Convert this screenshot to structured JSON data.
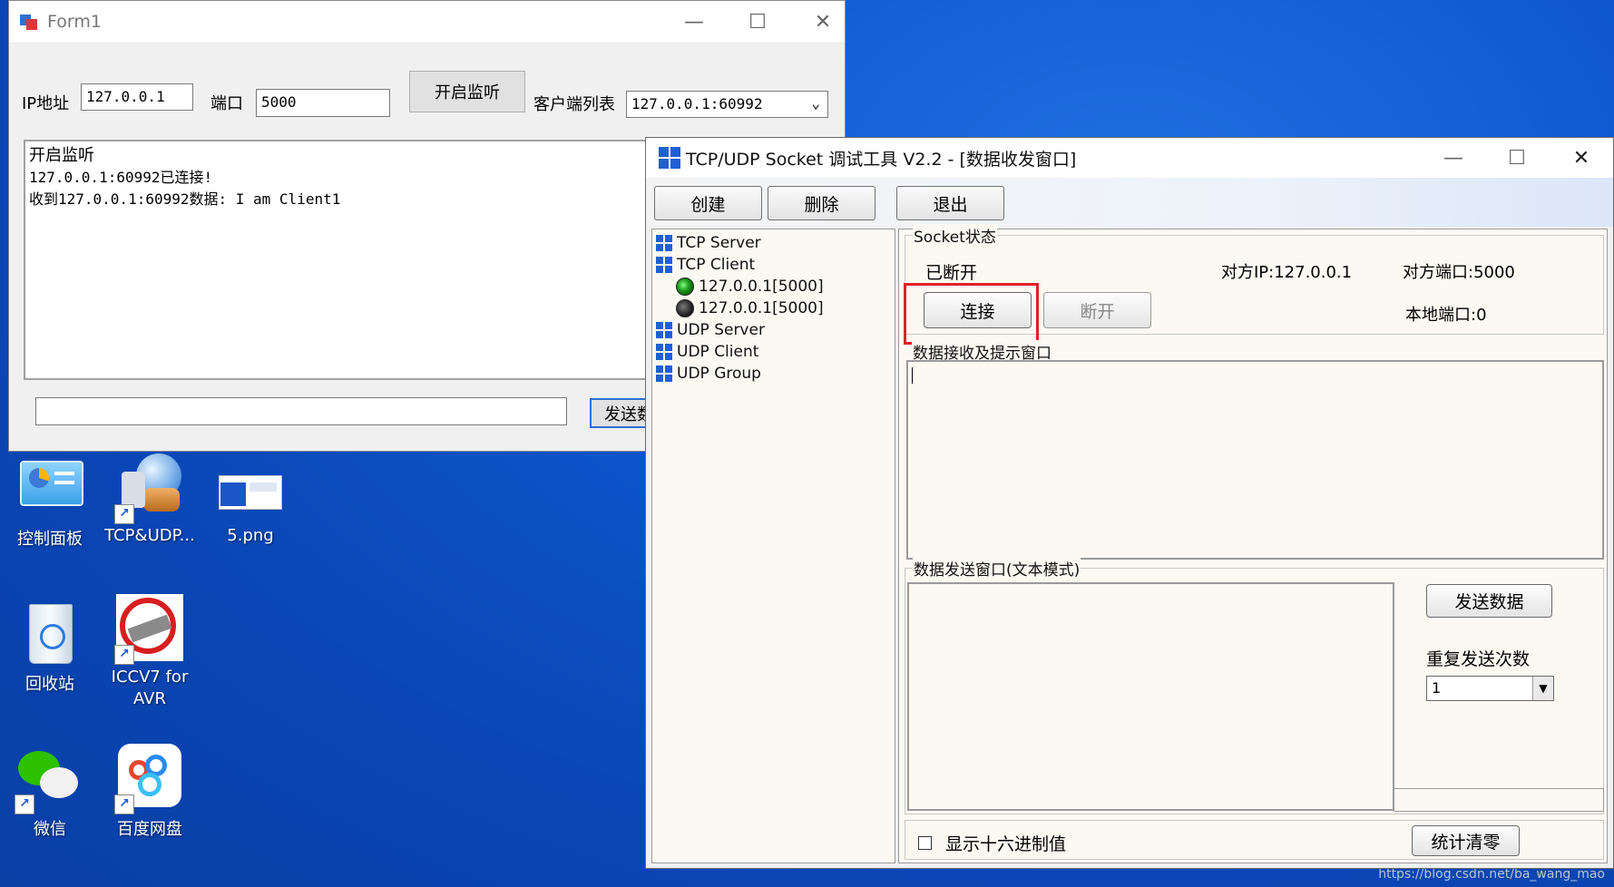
{
  "desktop": {
    "icons": [
      {
        "label": "控制面板"
      },
      {
        "label": "TCP&UDP..."
      },
      {
        "label": "5.png"
      },
      {
        "label": "回收站"
      },
      {
        "label": "ICCV7 for AVR"
      },
      {
        "label": "微信"
      },
      {
        "label": "百度网盘"
      }
    ],
    "watermark": "https://blog.csdn.net/ba_wang_mao"
  },
  "form1": {
    "title": "Form1",
    "ip_label": "IP地址",
    "ip_value": "127.0.0.1",
    "port_label": "端口",
    "port_value": "5000",
    "listen_button": "开启监听",
    "client_list_label": "客户端列表",
    "client_selected": "127.0.0.1:60992",
    "log_lines": [
      "开启监听",
      "127.0.0.1:60992已连接!",
      "收到127.0.0.1:60992数据: I am Client1"
    ],
    "send_input": "",
    "send_button": "发送数"
  },
  "tool": {
    "title": "TCP/UDP Socket 调试工具 V2.2 - [数据收发窗口]",
    "toolbar": {
      "create": "创建",
      "delete": "删除",
      "exit": "退出"
    },
    "tree": [
      {
        "label": "TCP Server",
        "icon": "windows-logo"
      },
      {
        "label": "TCP Client",
        "icon": "windows-logo"
      },
      {
        "label": "127.0.0.1[5000]",
        "icon": "green-led"
      },
      {
        "label": "127.0.0.1[5000]",
        "icon": "dark-led"
      },
      {
        "label": "UDP Server",
        "icon": "windows-logo"
      },
      {
        "label": "UDP Client",
        "icon": "windows-logo"
      },
      {
        "label": "UDP Group",
        "icon": "windows-logo"
      }
    ],
    "socket_group_label": "Socket状态",
    "status": "已断开",
    "remote_ip": "对方IP:127.0.0.1",
    "remote_port": "对方端口:5000",
    "connect_button": "连接",
    "disconnect_button": "断开",
    "local_port": "本地端口:0",
    "recv_group_label": "数据接收及提示窗口",
    "send_group_label": "数据发送窗口(文本模式)",
    "send_data_button": "发送数据",
    "repeat_label": "重复发送次数",
    "repeat_value": "1",
    "hex_checkbox_label": "显示十六进制值",
    "hex_checked": false,
    "clear_stats_button": "统计清零",
    "highlight_color": "#e0202a"
  }
}
